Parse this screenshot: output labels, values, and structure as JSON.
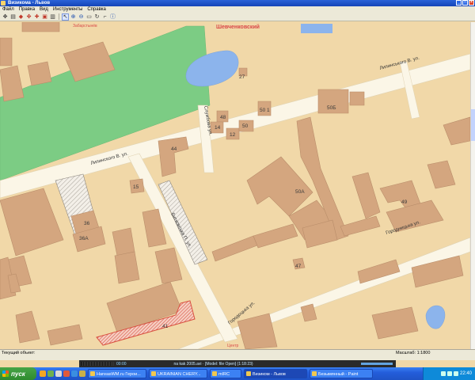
{
  "window": {
    "title": "Визикома - Львов",
    "buttons": {
      "minimize": "_",
      "maximize": "□",
      "close": "×"
    }
  },
  "menu": [
    "Файл",
    "Правка",
    "Вид",
    "Инструменты",
    "Справка"
  ],
  "toolbar": {
    "icons": [
      "move-icon",
      "layers-icon",
      "select-icon",
      "pan-icon",
      "route-icon",
      "marker-icon",
      "print-icon",
      "zoom-in-icon",
      "zoom-out-icon",
      "zoom-rect-icon",
      "refresh-icon",
      "ruler-icon",
      "info-icon"
    ]
  },
  "map": {
    "district_labels": [
      "Шевченковский",
      "Центр"
    ],
    "area_labels": [
      "Забарстынёв"
    ],
    "streets": {
      "lipinskogo_top": "Липинського В. ул.",
      "lipinskogo_left": "Липинского В. ул.",
      "sluzhbova": "Службова ул.",
      "bitkovskaya": "Битковська П. ул.",
      "gorodotskaya": "Городоцька ул.",
      "gorodnytska": "Городницька ул."
    },
    "house_numbers": [
      "27",
      "48",
      "14",
      "12",
      "50",
      "50 1",
      "50Б",
      "44",
      "15",
      "50А",
      "49",
      "36",
      "36А",
      "47",
      "41"
    ]
  },
  "status": {
    "object_label": "Текущий объект:",
    "scale_label": "Масштаб: 1:1800"
  },
  "player": {
    "time": "00:00",
    "track_text": "na kak 2005.avi  ·  [Model: file Open]  (1:18:23)"
  },
  "taskbar": {
    "start_label": "пуск",
    "tasks": [
      {
        "label": "HansasWM.ru Герои...",
        "active": false
      },
      {
        "label": "UKRAINIAN CHERY...",
        "active": false
      },
      {
        "label": "mIRC",
        "active": false
      },
      {
        "label": "Визиком - Львов",
        "active": true
      },
      {
        "label": "Безымянный - Paint",
        "active": false
      }
    ],
    "clock": "22:40"
  },
  "colors": {
    "map_bg": "#f1d8a8",
    "building": "#d4a67f",
    "building_stroke": "#b98d6a",
    "park": "#7ccc84",
    "water": "#8cb4ec",
    "road": "#fbf6e7",
    "selection": "#d85040"
  }
}
